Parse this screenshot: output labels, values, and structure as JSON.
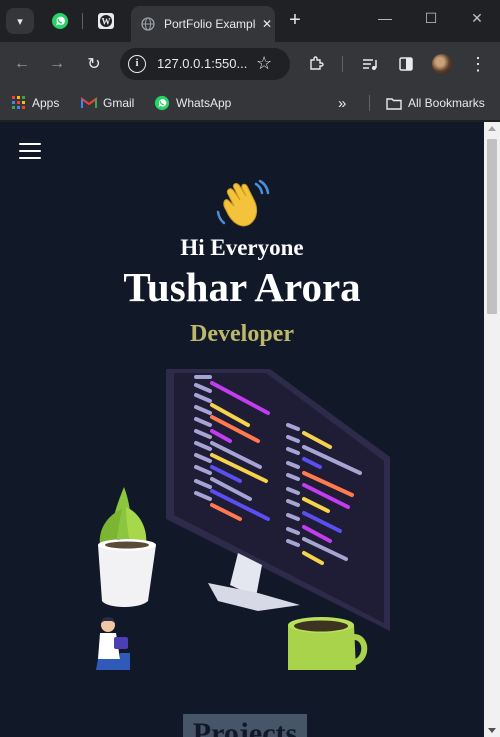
{
  "browser": {
    "active_tab_title": "PortFolio Example",
    "url": "127.0.0.1:550...",
    "bookmarks": {
      "apps": "Apps",
      "gmail": "Gmail",
      "whatsapp": "WhatsApp",
      "all": "All Bookmarks"
    }
  },
  "page": {
    "greeting": "Hi Everyone",
    "name": "Tushar Arora",
    "role": "Developer",
    "projects_heading": "Projects"
  },
  "colors": {
    "page_bg": "#111828",
    "role_text": "#bdb76b",
    "projects_bg": "#475569"
  },
  "icons": [
    "tab-search-icon",
    "whatsapp-icon",
    "wordpress-icon",
    "globe-icon",
    "close-icon",
    "plus-icon",
    "minimize-icon",
    "maximize-icon",
    "back-icon",
    "forward-icon",
    "reload-icon",
    "info-icon",
    "star-icon",
    "extensions-icon",
    "media-icon",
    "side-panel-icon",
    "menu-icon",
    "apps-icon",
    "gmail-icon",
    "folder-icon",
    "hamburger-icon",
    "waving-hand-icon"
  ]
}
